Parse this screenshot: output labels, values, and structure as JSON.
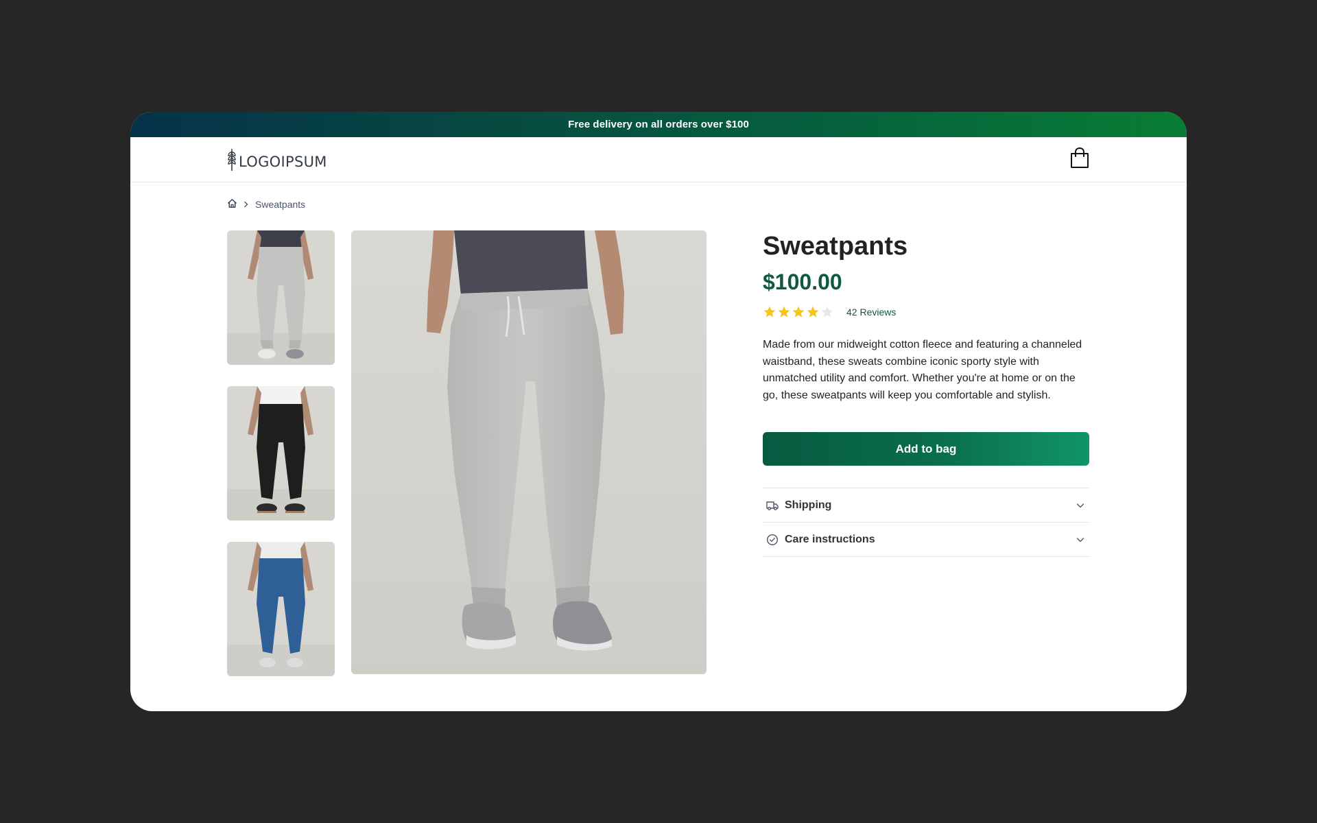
{
  "promo": {
    "text": "Free delivery on all orders over $100"
  },
  "header": {
    "logo_text": "LOGOIPSUM",
    "logo_icon": "wheat-icon",
    "bag_icon": "shopping-bag-icon"
  },
  "breadcrumb": {
    "home_icon": "home-icon",
    "separator_icon": "chevron-right-icon",
    "current": "Sweatpants"
  },
  "gallery": {
    "thumbnails": [
      {
        "variant": "light grey sweatpants",
        "pants_color": "#c2c2c0"
      },
      {
        "variant": "black sweatpants",
        "pants_color": "#1d1d1d"
      },
      {
        "variant": "blue sweatpants",
        "pants_color": "#2f5f97"
      }
    ],
    "main_image": {
      "variant": "light grey sweatpants",
      "pants_color": "#bebebc"
    }
  },
  "product": {
    "title": "Sweatpants",
    "price": "$100.00",
    "rating": 4,
    "rating_max": 5,
    "reviews_label": "42 Reviews",
    "description": "Made from our midweight cotton fleece and featuring a channeled waistband, these sweats combine iconic sporty style with unmatched utility and comfort. Whether you're at home or on the go, these sweatpants will keep you comfortable and stylish.",
    "add_to_bag_label": "Add to bag"
  },
  "accordion": [
    {
      "label": "Shipping",
      "icon": "truck-icon",
      "chevron": "chevron-down-icon"
    },
    {
      "label": "Care instructions",
      "icon": "check-circle-icon",
      "chevron": "chevron-down-icon"
    }
  ],
  "colors": {
    "brand_green": "#0f5a3f",
    "star_filled": "#f5c518",
    "star_empty": "#e5e7eb",
    "page_bg": "#262626"
  }
}
